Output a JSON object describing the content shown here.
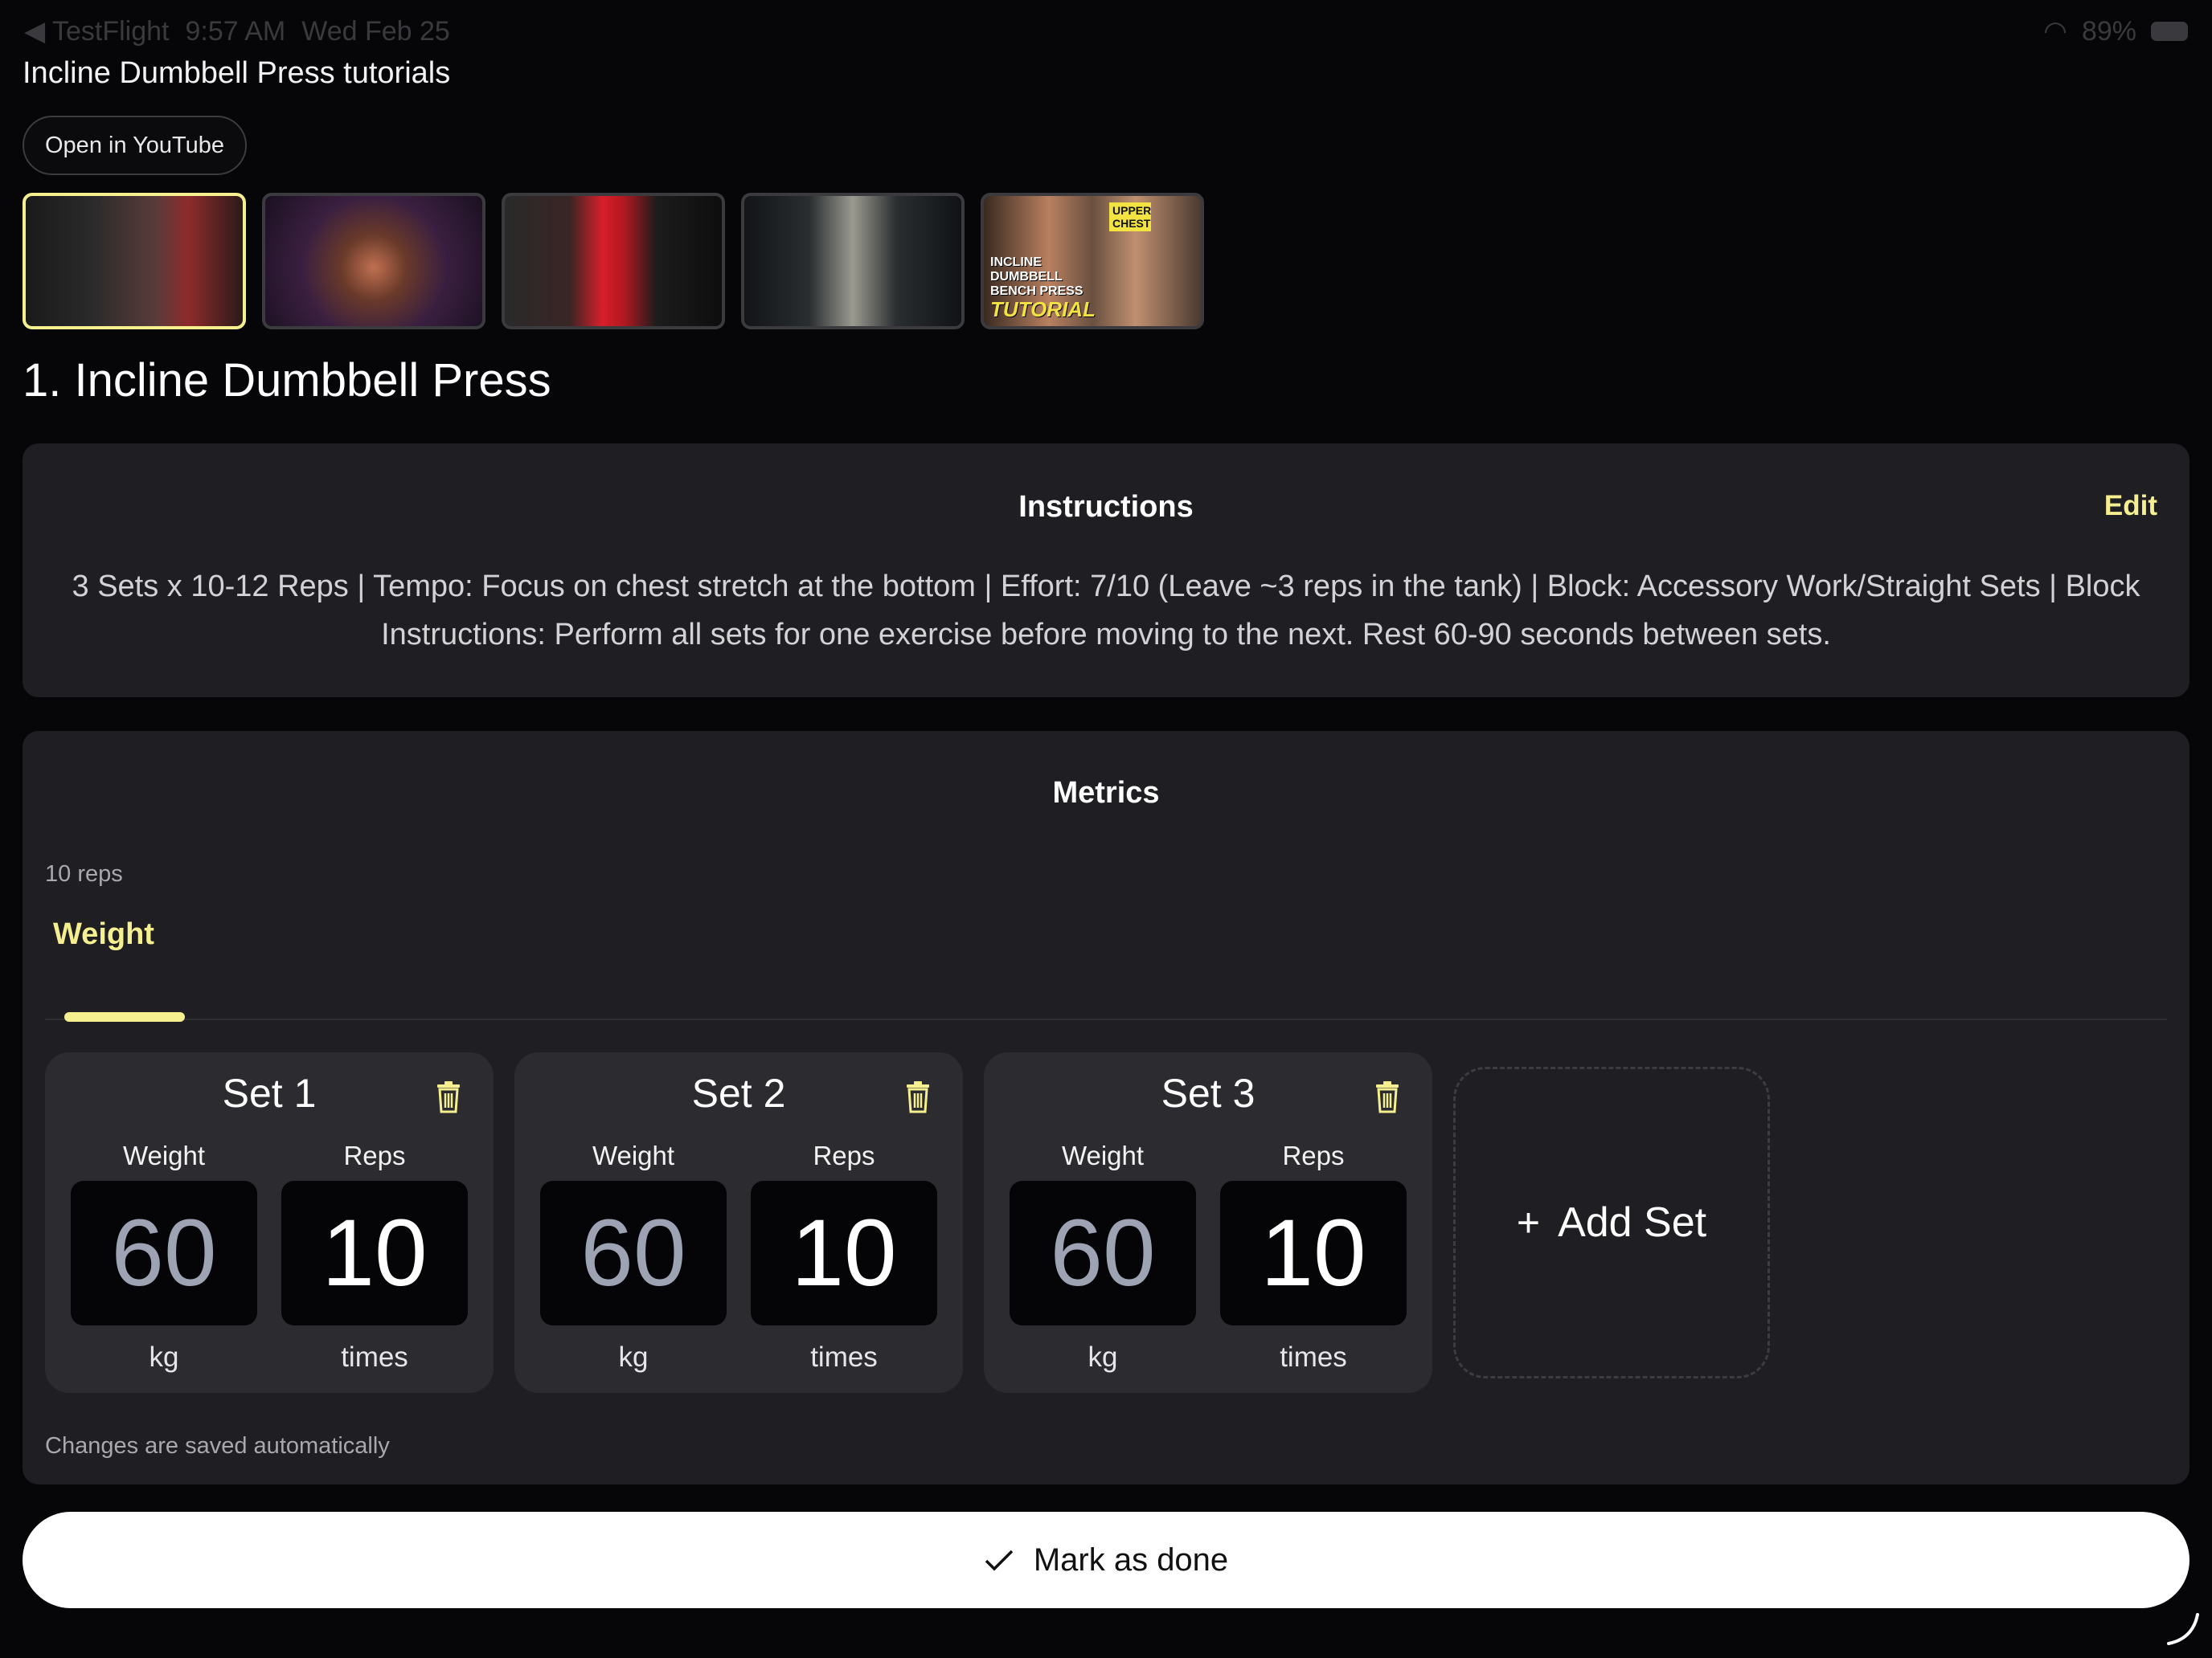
{
  "status_bar": {
    "back_app": "◀ TestFlight",
    "time": "9:57 AM",
    "date": "Wed Feb 25",
    "battery": "89%"
  },
  "tutorials": {
    "title": "Incline Dumbbell Press tutorials",
    "open_button": "Open in YouTube",
    "selected_index": 0,
    "thumb5_chip": "UPPER CHEST",
    "thumb5_caption": "INCLINE DUMBBELL BENCH PRESS",
    "thumb5_caption_2": "TUTORIAL"
  },
  "exercise": {
    "title": "1. Incline Dumbbell Press"
  },
  "instructions": {
    "title": "Instructions",
    "edit_label": "Edit",
    "text": "3 Sets x 10-12 Reps | Tempo: Focus on chest stretch at the bottom | Effort: 7/10 (Leave ~3 reps in the tank) | Block: Accessory Work/Straight Sets | Block Instructions: Perform all sets for one exercise before moving to the next. Rest 60-90 seconds between sets."
  },
  "metrics": {
    "title": "Metrics",
    "reps_label": "10 reps",
    "tab": "Weight",
    "sets": [
      {
        "title": "Set 1",
        "weight_label": "Weight",
        "reps_label": "Reps",
        "weight": "60",
        "reps": "10",
        "weight_unit": "kg",
        "reps_unit": "times"
      },
      {
        "title": "Set 2",
        "weight_label": "Weight",
        "reps_label": "Reps",
        "weight": "60",
        "reps": "10",
        "weight_unit": "kg",
        "reps_unit": "times"
      },
      {
        "title": "Set 3",
        "weight_label": "Weight",
        "reps_label": "Reps",
        "weight": "60",
        "reps": "10",
        "weight_unit": "kg",
        "reps_unit": "times"
      }
    ],
    "add_set_label": "Add Set",
    "autosave_note": "Changes are saved automatically"
  },
  "footer": {
    "done_label": "Mark as done"
  },
  "colors": {
    "accent": "#f5ef8f",
    "card": "#1f1f23",
    "background": "#060608"
  }
}
